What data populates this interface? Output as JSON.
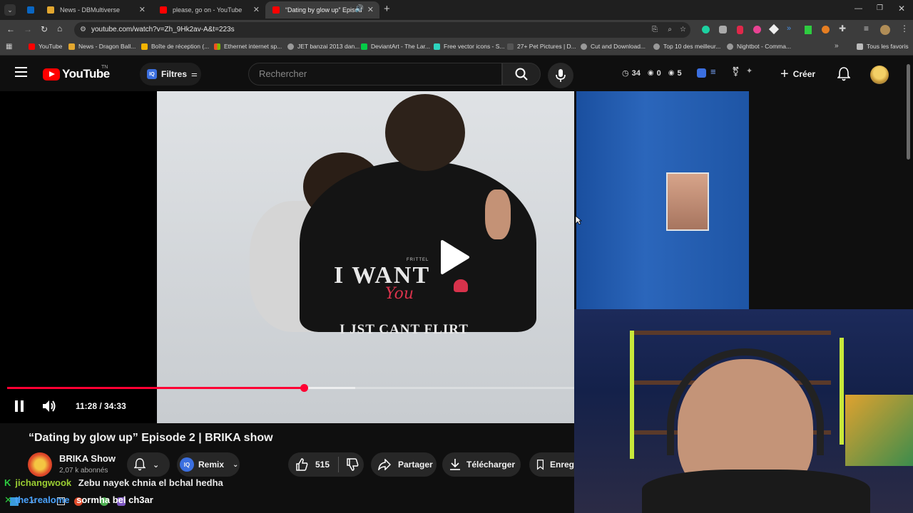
{
  "browser": {
    "tabs": [
      {
        "label": "",
        "color": "#0a66c2"
      },
      {
        "label": "News - DBMultiverse",
        "color": "#e3a72f"
      },
      {
        "label": "please, go on - YouTube",
        "color": "#ff0000"
      },
      {
        "label": "“Dating by glow up” Episod",
        "color": "#ff0000"
      }
    ],
    "url": "youtube.com/watch?v=Zh_9Hk2av-A&t=223s",
    "bookmarks": [
      "YouTube",
      "News - Dragon Ball...",
      "Boîte de réception (...",
      "Ethernet internet sp...",
      "JET banzai 2013 dan...",
      "DeviantArt - The Lar...",
      "Free vector icons - S...",
      "27+ Pet Pictures | D...",
      "Cut and Download...",
      "Top 10 des meilleur...",
      "Nightbot - Comma..."
    ],
    "all_bookmarks": "Tous les favoris"
  },
  "youtube": {
    "logo": "YouTube",
    "country": "TN",
    "filters": "Filtres",
    "iq_badge": "IQ",
    "search_placeholder": "Rechercher",
    "stats": {
      "watch": "34",
      "views": "0",
      "eye": "5"
    },
    "create": "Créer"
  },
  "player": {
    "hoodie_line1": "I WANT",
    "hoodie_script": "You",
    "hoodie_line2": "I JST CANT FLIRT",
    "hoodie_brand": "FRITTEL",
    "time_current": "11:28",
    "time_separator": " / ",
    "time_total": "34:33",
    "progress_fraction": 0.332
  },
  "video": {
    "title": "“Dating by glow up” Episode 2 | BRIKA show",
    "channel": "BRIKA Show",
    "subscribers": "2,07 k abonnés",
    "remix": "Remix",
    "likes": "515",
    "share": "Partager",
    "download": "Télécharger",
    "save": "Enreg"
  },
  "chat": [
    {
      "user": "jichangwook",
      "message": "Zebu nayek chnia el bchal hedha",
      "user_color": "#9acd32"
    },
    {
      "user": "the1realome",
      "message": "sormha bel ch3ar",
      "user_color": "#4aa3ff"
    }
  ]
}
